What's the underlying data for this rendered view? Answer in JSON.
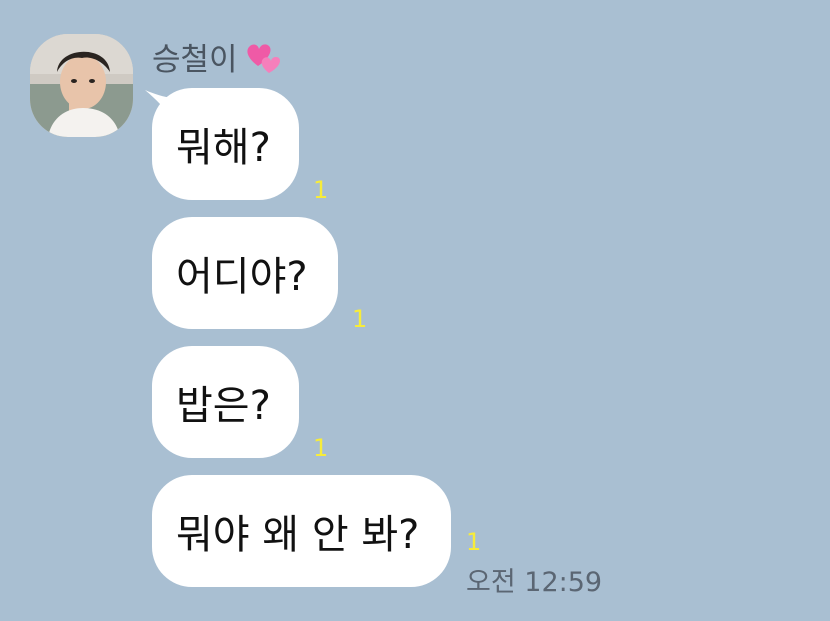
{
  "chat": {
    "sender_name": "승철이",
    "sender_emoji_icon": "two-hearts-icon",
    "messages": [
      {
        "text": "뭐해?",
        "unread": "1"
      },
      {
        "text": "어디야?",
        "unread": "1"
      },
      {
        "text": "밥은?",
        "unread": "1"
      },
      {
        "text": "뭐야 왜 안 봐?",
        "unread": "1"
      }
    ],
    "last_time": "오전 12:59"
  },
  "colors": {
    "background": "#a9bfd2",
    "bubble": "#ffffff",
    "unread": "#f7ec3a",
    "time": "#5b6673"
  }
}
